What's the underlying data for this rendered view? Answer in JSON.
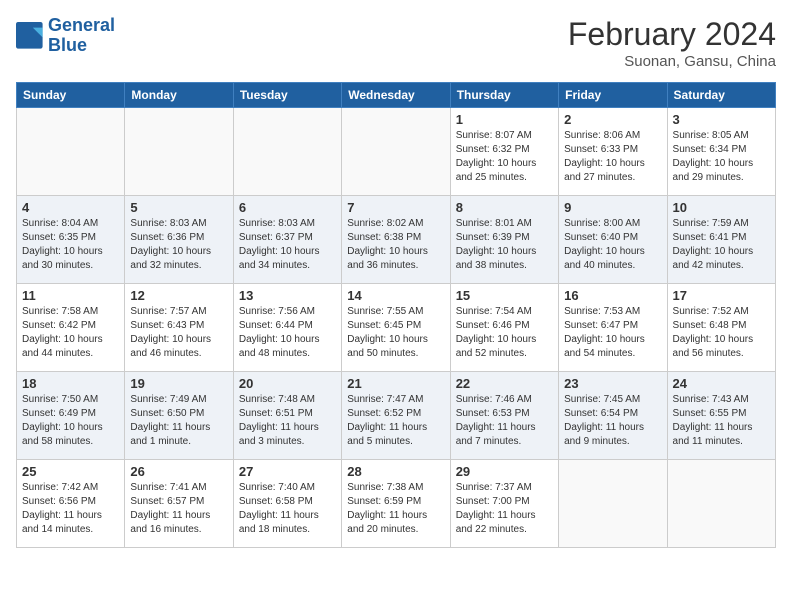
{
  "header": {
    "logo_line1": "General",
    "logo_line2": "Blue",
    "month_year": "February 2024",
    "location": "Suonan, Gansu, China"
  },
  "days_of_week": [
    "Sunday",
    "Monday",
    "Tuesday",
    "Wednesday",
    "Thursday",
    "Friday",
    "Saturday"
  ],
  "weeks": [
    [
      {
        "day": "",
        "info": ""
      },
      {
        "day": "",
        "info": ""
      },
      {
        "day": "",
        "info": ""
      },
      {
        "day": "",
        "info": ""
      },
      {
        "day": "1",
        "info": "Sunrise: 8:07 AM\nSunset: 6:32 PM\nDaylight: 10 hours and 25 minutes."
      },
      {
        "day": "2",
        "info": "Sunrise: 8:06 AM\nSunset: 6:33 PM\nDaylight: 10 hours and 27 minutes."
      },
      {
        "day": "3",
        "info": "Sunrise: 8:05 AM\nSunset: 6:34 PM\nDaylight: 10 hours and 29 minutes."
      }
    ],
    [
      {
        "day": "4",
        "info": "Sunrise: 8:04 AM\nSunset: 6:35 PM\nDaylight: 10 hours and 30 minutes."
      },
      {
        "day": "5",
        "info": "Sunrise: 8:03 AM\nSunset: 6:36 PM\nDaylight: 10 hours and 32 minutes."
      },
      {
        "day": "6",
        "info": "Sunrise: 8:03 AM\nSunset: 6:37 PM\nDaylight: 10 hours and 34 minutes."
      },
      {
        "day": "7",
        "info": "Sunrise: 8:02 AM\nSunset: 6:38 PM\nDaylight: 10 hours and 36 minutes."
      },
      {
        "day": "8",
        "info": "Sunrise: 8:01 AM\nSunset: 6:39 PM\nDaylight: 10 hours and 38 minutes."
      },
      {
        "day": "9",
        "info": "Sunrise: 8:00 AM\nSunset: 6:40 PM\nDaylight: 10 hours and 40 minutes."
      },
      {
        "day": "10",
        "info": "Sunrise: 7:59 AM\nSunset: 6:41 PM\nDaylight: 10 hours and 42 minutes."
      }
    ],
    [
      {
        "day": "11",
        "info": "Sunrise: 7:58 AM\nSunset: 6:42 PM\nDaylight: 10 hours and 44 minutes."
      },
      {
        "day": "12",
        "info": "Sunrise: 7:57 AM\nSunset: 6:43 PM\nDaylight: 10 hours and 46 minutes."
      },
      {
        "day": "13",
        "info": "Sunrise: 7:56 AM\nSunset: 6:44 PM\nDaylight: 10 hours and 48 minutes."
      },
      {
        "day": "14",
        "info": "Sunrise: 7:55 AM\nSunset: 6:45 PM\nDaylight: 10 hours and 50 minutes."
      },
      {
        "day": "15",
        "info": "Sunrise: 7:54 AM\nSunset: 6:46 PM\nDaylight: 10 hours and 52 minutes."
      },
      {
        "day": "16",
        "info": "Sunrise: 7:53 AM\nSunset: 6:47 PM\nDaylight: 10 hours and 54 minutes."
      },
      {
        "day": "17",
        "info": "Sunrise: 7:52 AM\nSunset: 6:48 PM\nDaylight: 10 hours and 56 minutes."
      }
    ],
    [
      {
        "day": "18",
        "info": "Sunrise: 7:50 AM\nSunset: 6:49 PM\nDaylight: 10 hours and 58 minutes."
      },
      {
        "day": "19",
        "info": "Sunrise: 7:49 AM\nSunset: 6:50 PM\nDaylight: 11 hours and 1 minute."
      },
      {
        "day": "20",
        "info": "Sunrise: 7:48 AM\nSunset: 6:51 PM\nDaylight: 11 hours and 3 minutes."
      },
      {
        "day": "21",
        "info": "Sunrise: 7:47 AM\nSunset: 6:52 PM\nDaylight: 11 hours and 5 minutes."
      },
      {
        "day": "22",
        "info": "Sunrise: 7:46 AM\nSunset: 6:53 PM\nDaylight: 11 hours and 7 minutes."
      },
      {
        "day": "23",
        "info": "Sunrise: 7:45 AM\nSunset: 6:54 PM\nDaylight: 11 hours and 9 minutes."
      },
      {
        "day": "24",
        "info": "Sunrise: 7:43 AM\nSunset: 6:55 PM\nDaylight: 11 hours and 11 minutes."
      }
    ],
    [
      {
        "day": "25",
        "info": "Sunrise: 7:42 AM\nSunset: 6:56 PM\nDaylight: 11 hours and 14 minutes."
      },
      {
        "day": "26",
        "info": "Sunrise: 7:41 AM\nSunset: 6:57 PM\nDaylight: 11 hours and 16 minutes."
      },
      {
        "day": "27",
        "info": "Sunrise: 7:40 AM\nSunset: 6:58 PM\nDaylight: 11 hours and 18 minutes."
      },
      {
        "day": "28",
        "info": "Sunrise: 7:38 AM\nSunset: 6:59 PM\nDaylight: 11 hours and 20 minutes."
      },
      {
        "day": "29",
        "info": "Sunrise: 7:37 AM\nSunset: 7:00 PM\nDaylight: 11 hours and 22 minutes."
      },
      {
        "day": "",
        "info": ""
      },
      {
        "day": "",
        "info": ""
      }
    ]
  ]
}
